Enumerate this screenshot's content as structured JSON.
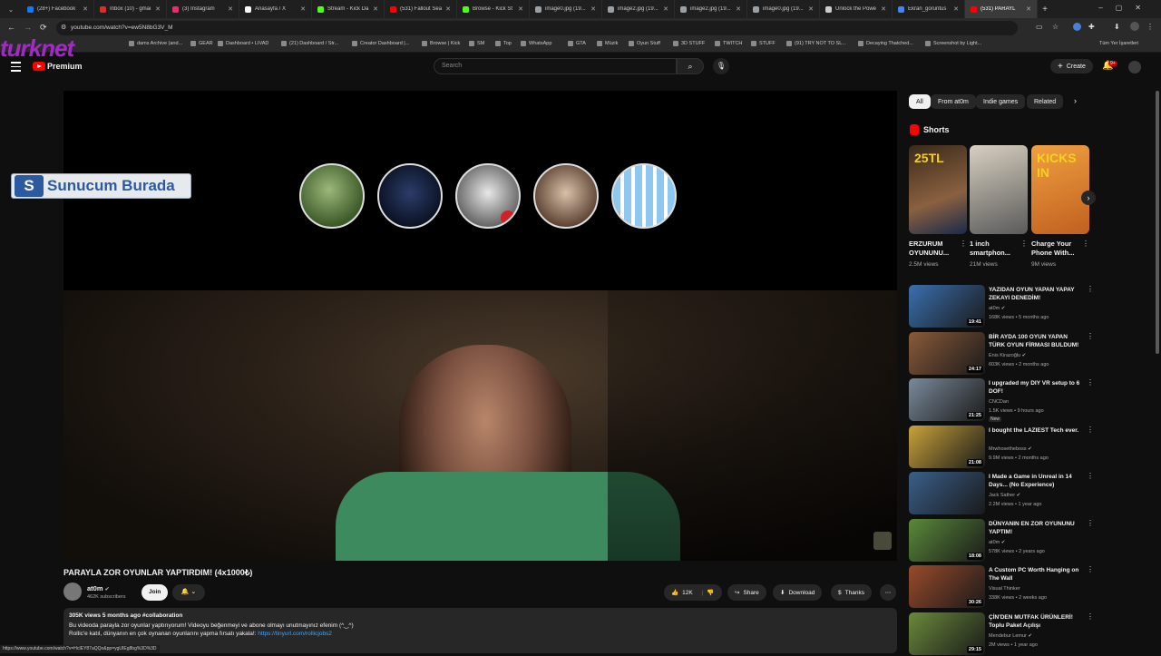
{
  "browser": {
    "tabs": [
      {
        "label": "(28+) Facebook",
        "color": "#1877f2"
      },
      {
        "label": "Inbox (10) - gmai",
        "color": "#d93025"
      },
      {
        "label": "(3) Instagram",
        "color": "#e1306c"
      },
      {
        "label": "Anasayfa / X",
        "color": "#ffffff"
      },
      {
        "label": "Stream - Kick Da",
        "color": "#53fc18"
      },
      {
        "label": "(531) Fallout Sea",
        "color": "#ff0000"
      },
      {
        "label": "Browse - Kick St",
        "color": "#53fc18"
      },
      {
        "label": "image0.jpg (19...",
        "color": "#9aa0a6"
      },
      {
        "label": "image2.jpg (19...",
        "color": "#9aa0a6"
      },
      {
        "label": "image2.jpg (19...",
        "color": "#9aa0a6"
      },
      {
        "label": "image0.jpg (19...",
        "color": "#9aa0a6"
      },
      {
        "label": "Unlock the Powe",
        "color": "#cccccc"
      },
      {
        "label": "Ekran_goruntus",
        "color": "#4285f4"
      },
      {
        "label": "(531) PARAYL",
        "color": "#ff0000"
      }
    ],
    "new_tab": "+",
    "url": "youtube.com/watch?v=ew5N8bG3V_M",
    "bookmarks": [
      "dams Archive (and...",
      "GEAR",
      "Dashboard • LIVAD",
      "(21) Dashboard / Str...",
      "Creator Dashboard |...",
      "Browse | Kick",
      "SM",
      "Top",
      "WhatsApp",
      "GTA",
      "Müzik",
      "Oyun Stuff",
      "3D STUFF",
      "TWITCH",
      "STUFF",
      "(91) TRY NOT TO SL...",
      "Decaying Thatched...",
      "Screenshot by Light..."
    ],
    "all_bookmarks": "Tüm Yer İşaretleri",
    "overlay_logo": "turknet"
  },
  "header": {
    "logo_text": "Premium",
    "search_placeholder": "Search",
    "create_label": "Create",
    "notif_count": "9+"
  },
  "player": {
    "sponsor_text": "Sunucum Burada"
  },
  "video": {
    "title": "PARAYLA ZOR OYUNLAR YAPTIRDIM! (4x1000₺)",
    "channel": "at0m",
    "subs": "462K subscribers",
    "join": "Join",
    "likes": "12K",
    "share": "Share",
    "download": "Download",
    "thanks": "Thanks",
    "desc_meta": "305K views  5 months ago  #collaboration",
    "desc_line1": "Bu videoda parayla zor oyunlar yaptırıyorum! Videoyu beğenmeyi ve abone olmayı unutmayınız efenim (^‿^)",
    "desc_line2": "Rollic'e katıl, dünyanın en çok oynanan oyunlarını yapma fırsatı yakala!:",
    "desc_link": "https://tinyurl.com/rollicjobs2",
    "status_url": "https://www.youtube.com/watch?v=HcIEY87aQQo&pp=ygUIEg8bg%3D%3D"
  },
  "sidebar": {
    "chips": [
      "All",
      "From at0m",
      "Indie games",
      "Related"
    ],
    "shorts_title": "Shorts",
    "shorts": [
      {
        "title": "ERZURUM OYUNUNU...",
        "views": "2.5M views",
        "overlay": "25TL"
      },
      {
        "title": "1 inch smartphon...",
        "views": "21M views",
        "overlay": ""
      },
      {
        "title": "Charge Your Phone With...",
        "views": "9M views",
        "overlay": "KICKS IN"
      }
    ],
    "recs": [
      {
        "title": "YAZIDAN OYUN YAPAN YAPAY ZEKAYI DENEDİM!",
        "channel": "at0m ✔",
        "meta": "168K views • 5 months ago",
        "dur": "19:41",
        "badge": "",
        "color": "#3a6fb0"
      },
      {
        "title": "BİR AYDA 100 OYUN YAPAN TÜRK OYUN FİRMASI BULDUM!",
        "channel": "Enis Kirazoğlu ✔",
        "meta": "603K views • 2 months ago",
        "dur": "24:17",
        "badge": "",
        "color": "#8a5a3a"
      },
      {
        "title": "I upgraded my DIY VR setup to 6 DOF!",
        "channel": "CNCDan",
        "meta": "1.5K views • 9 hours ago",
        "dur": "21:25",
        "badge": "New",
        "color": "#7a8a9a"
      },
      {
        "title": "I bought the LAZIEST Tech ever.",
        "channel": "Mrwhosetheboss ✔",
        "meta": "9.9M views • 2 months ago",
        "dur": "21:08",
        "badge": "",
        "color": "#c9a23a"
      },
      {
        "title": "I Made a Game in Unreal in 14 Days... (No Experience)",
        "channel": "Jack Sather ✔",
        "meta": "2.2M views • 1 year ago",
        "dur": "",
        "badge": "",
        "color": "#3a5f8a"
      },
      {
        "title": "DÜNYANIN EN ZOR OYUNUNU YAPTIM!",
        "channel": "at0m ✔",
        "meta": "578K views • 2 years ago",
        "dur": "18:08",
        "badge": "",
        "color": "#5a8a3a"
      },
      {
        "title": "A Custom PC Worth Hanging on The Wall",
        "channel": "Visual Thinker",
        "meta": "338K views • 2 weeks ago",
        "dur": "30:26",
        "badge": "",
        "color": "#9a4a2a"
      },
      {
        "title": "ÇİN'DEN MUTFAK ÜRÜNLERİ! Toplu Paket Açılışı",
        "channel": "Mendebur Lemur ✔",
        "meta": "2M views • 1 year ago",
        "dur": "29:15",
        "badge": "",
        "color": "#6a8a3a"
      }
    ]
  }
}
